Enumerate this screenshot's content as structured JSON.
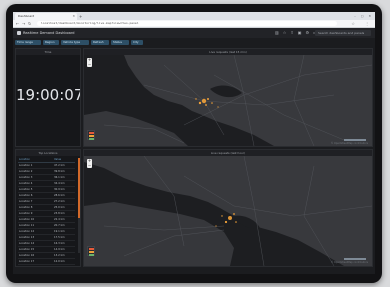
{
  "browser": {
    "tab_title": "Dashboard",
    "url": "localhost/dashboard/monitoring/live-map?view=two-panel",
    "window_controls": "– ▢ ✕"
  },
  "header": {
    "title": "Realtime Demand Dashboard",
    "search_text": "Search dashboards and panels"
  },
  "filters": [
    {
      "label": "Time range"
    },
    {
      "label": "Region"
    },
    {
      "label": "Vehicle type"
    },
    {
      "label": "Refresh"
    },
    {
      "label": "Status"
    },
    {
      "label": "City"
    }
  ],
  "clock_panel": {
    "title": "Time",
    "value": "19:00:07"
  },
  "table_panel": {
    "title": "Top Locations",
    "columns": [
      "Location",
      "Value"
    ],
    "rows": [
      [
        "Location 1",
        "47.2 km"
      ],
      [
        "Location 2",
        "39.8 km"
      ],
      [
        "Location 3",
        "36.1 km"
      ],
      [
        "Location 4",
        "34.4 km"
      ],
      [
        "Location 5",
        "30.9 km"
      ],
      [
        "Location 6",
        "28.6 km"
      ],
      [
        "Location 7",
        "27.2 km"
      ],
      [
        "Location 8",
        "25.0 km"
      ],
      [
        "Location 9",
        "23.8 km"
      ],
      [
        "Location 10",
        "22.4 km"
      ],
      [
        "Location 11",
        "20.7 km"
      ],
      [
        "Location 12",
        "19.1 km"
      ],
      [
        "Location 13",
        "17.5 km"
      ],
      [
        "Location 14",
        "16.3 km"
      ],
      [
        "Location 15",
        "14.9 km"
      ],
      [
        "Location 16",
        "13.2 km"
      ],
      [
        "Location 17",
        "12.0 km"
      ]
    ]
  },
  "map_top": {
    "title": "Live requests (last 15 min)"
  },
  "map_bottom": {
    "title": "Live requests (last hour)"
  },
  "map_attribution": "© OpenStreetMap contributors",
  "colors": {
    "accent": "#d2692a",
    "hotspot": "#f2a23a",
    "water": "#1d1e21",
    "land": "#393a3e",
    "chip": "#2d4f66"
  }
}
